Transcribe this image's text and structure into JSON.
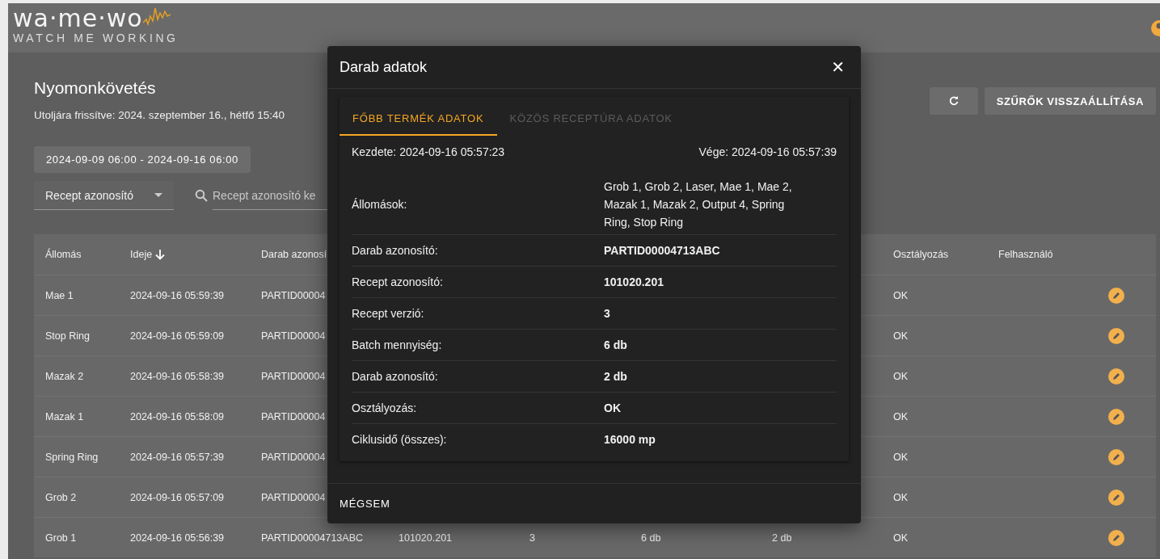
{
  "header": {
    "logo": "wa·me·wo",
    "tagline": "WATCH ME WORKING"
  },
  "page": {
    "title": "Nyomonkövetés",
    "updated": "Utoljára frissítve: 2024. szeptember 16., hétfő 15:40",
    "reset_button": "SZŰRŐK VISSZAÁLLÍTÁSA"
  },
  "filters": {
    "date_range": "2024-09-09 06:00 - 2024-09-16 06:00",
    "field_select": "Recept azonosító",
    "search": {
      "placeholder": "Recept azonosító ke"
    }
  },
  "table": {
    "columns": [
      {
        "label": "Állomás",
        "sorted_desc": false
      },
      {
        "label": "Ideje",
        "sorted_desc": true
      },
      {
        "label": "Darab azonosí",
        "sorted_desc": false
      },
      {},
      {},
      {},
      {},
      {
        "label": "Osztályozás",
        "sorted_desc": false
      },
      {
        "label": "Felhasználó",
        "sorted_desc": false
      }
    ],
    "rows": [
      {
        "cells": [
          "Mae 1",
          "2024-09-16 05:59:39",
          "PARTID00004",
          "",
          "",
          "",
          "",
          "OK",
          ""
        ]
      },
      {
        "cells": [
          "Stop Ring",
          "2024-09-16 05:59:09",
          "PARTID00004",
          "",
          "",
          "",
          "",
          "OK",
          ""
        ]
      },
      {
        "cells": [
          "Mazak 2",
          "2024-09-16 05:58:39",
          "PARTID00004",
          "",
          "",
          "",
          "",
          "OK",
          ""
        ]
      },
      {
        "cells": [
          "Mazak 1",
          "2024-09-16 05:58:09",
          "PARTID00004",
          "",
          "",
          "",
          "",
          "OK",
          ""
        ]
      },
      {
        "cells": [
          "Spring Ring",
          "2024-09-16 05:57:39",
          "PARTID00004",
          "",
          "",
          "",
          "",
          "OK",
          ""
        ]
      },
      {
        "cells": [
          "Grob 2",
          "2024-09-16 05:57:09",
          "PARTID00004",
          "",
          "",
          "",
          "",
          "OK",
          ""
        ]
      },
      {
        "cells": [
          "Grob 1",
          "2024-09-16 05:56:39",
          "PARTID00004713ABC",
          "101020.201",
          "3",
          "6 db",
          "2 db",
          "OK",
          ""
        ]
      }
    ]
  },
  "dialog": {
    "title": "Darab adatok",
    "close": "✕",
    "tabs": [
      {
        "label": "FŐBB TERMÉK ADATOK",
        "selected": true
      },
      {
        "label": "KÖZÖS RECEPTÚRA ADATOK",
        "selected": false
      }
    ],
    "start": "Kezdete: 2024-09-16 05:57:23",
    "end": "Vége: 2024-09-16 05:57:39",
    "fields": [
      {
        "label": "Állomások:",
        "value": "Grob 1, Grob 2, Laser, Mae 1, Mae 2, Mazak 1, Mazak 2, Output 4, Spring Ring, Stop Ring",
        "bold": false
      },
      {
        "label": "Darab azonosító:",
        "value": "PARTID00004713ABC",
        "bold": true
      },
      {
        "label": "Recept azonosító:",
        "value": "101020.201",
        "bold": true
      },
      {
        "label": "Recept verzió:",
        "value": "3",
        "bold": true
      },
      {
        "label": "Batch mennyiség:",
        "value": "6 db",
        "bold": true
      },
      {
        "label": "Darab azonosító:",
        "value": "2 db",
        "bold": true
      },
      {
        "label": "Osztályozás:",
        "value": "OK",
        "bold": true
      },
      {
        "label": "Ciklusidő (összes):",
        "value": "16000 mp",
        "bold": true
      }
    ],
    "cancel_button": "MÉGSEM"
  }
}
